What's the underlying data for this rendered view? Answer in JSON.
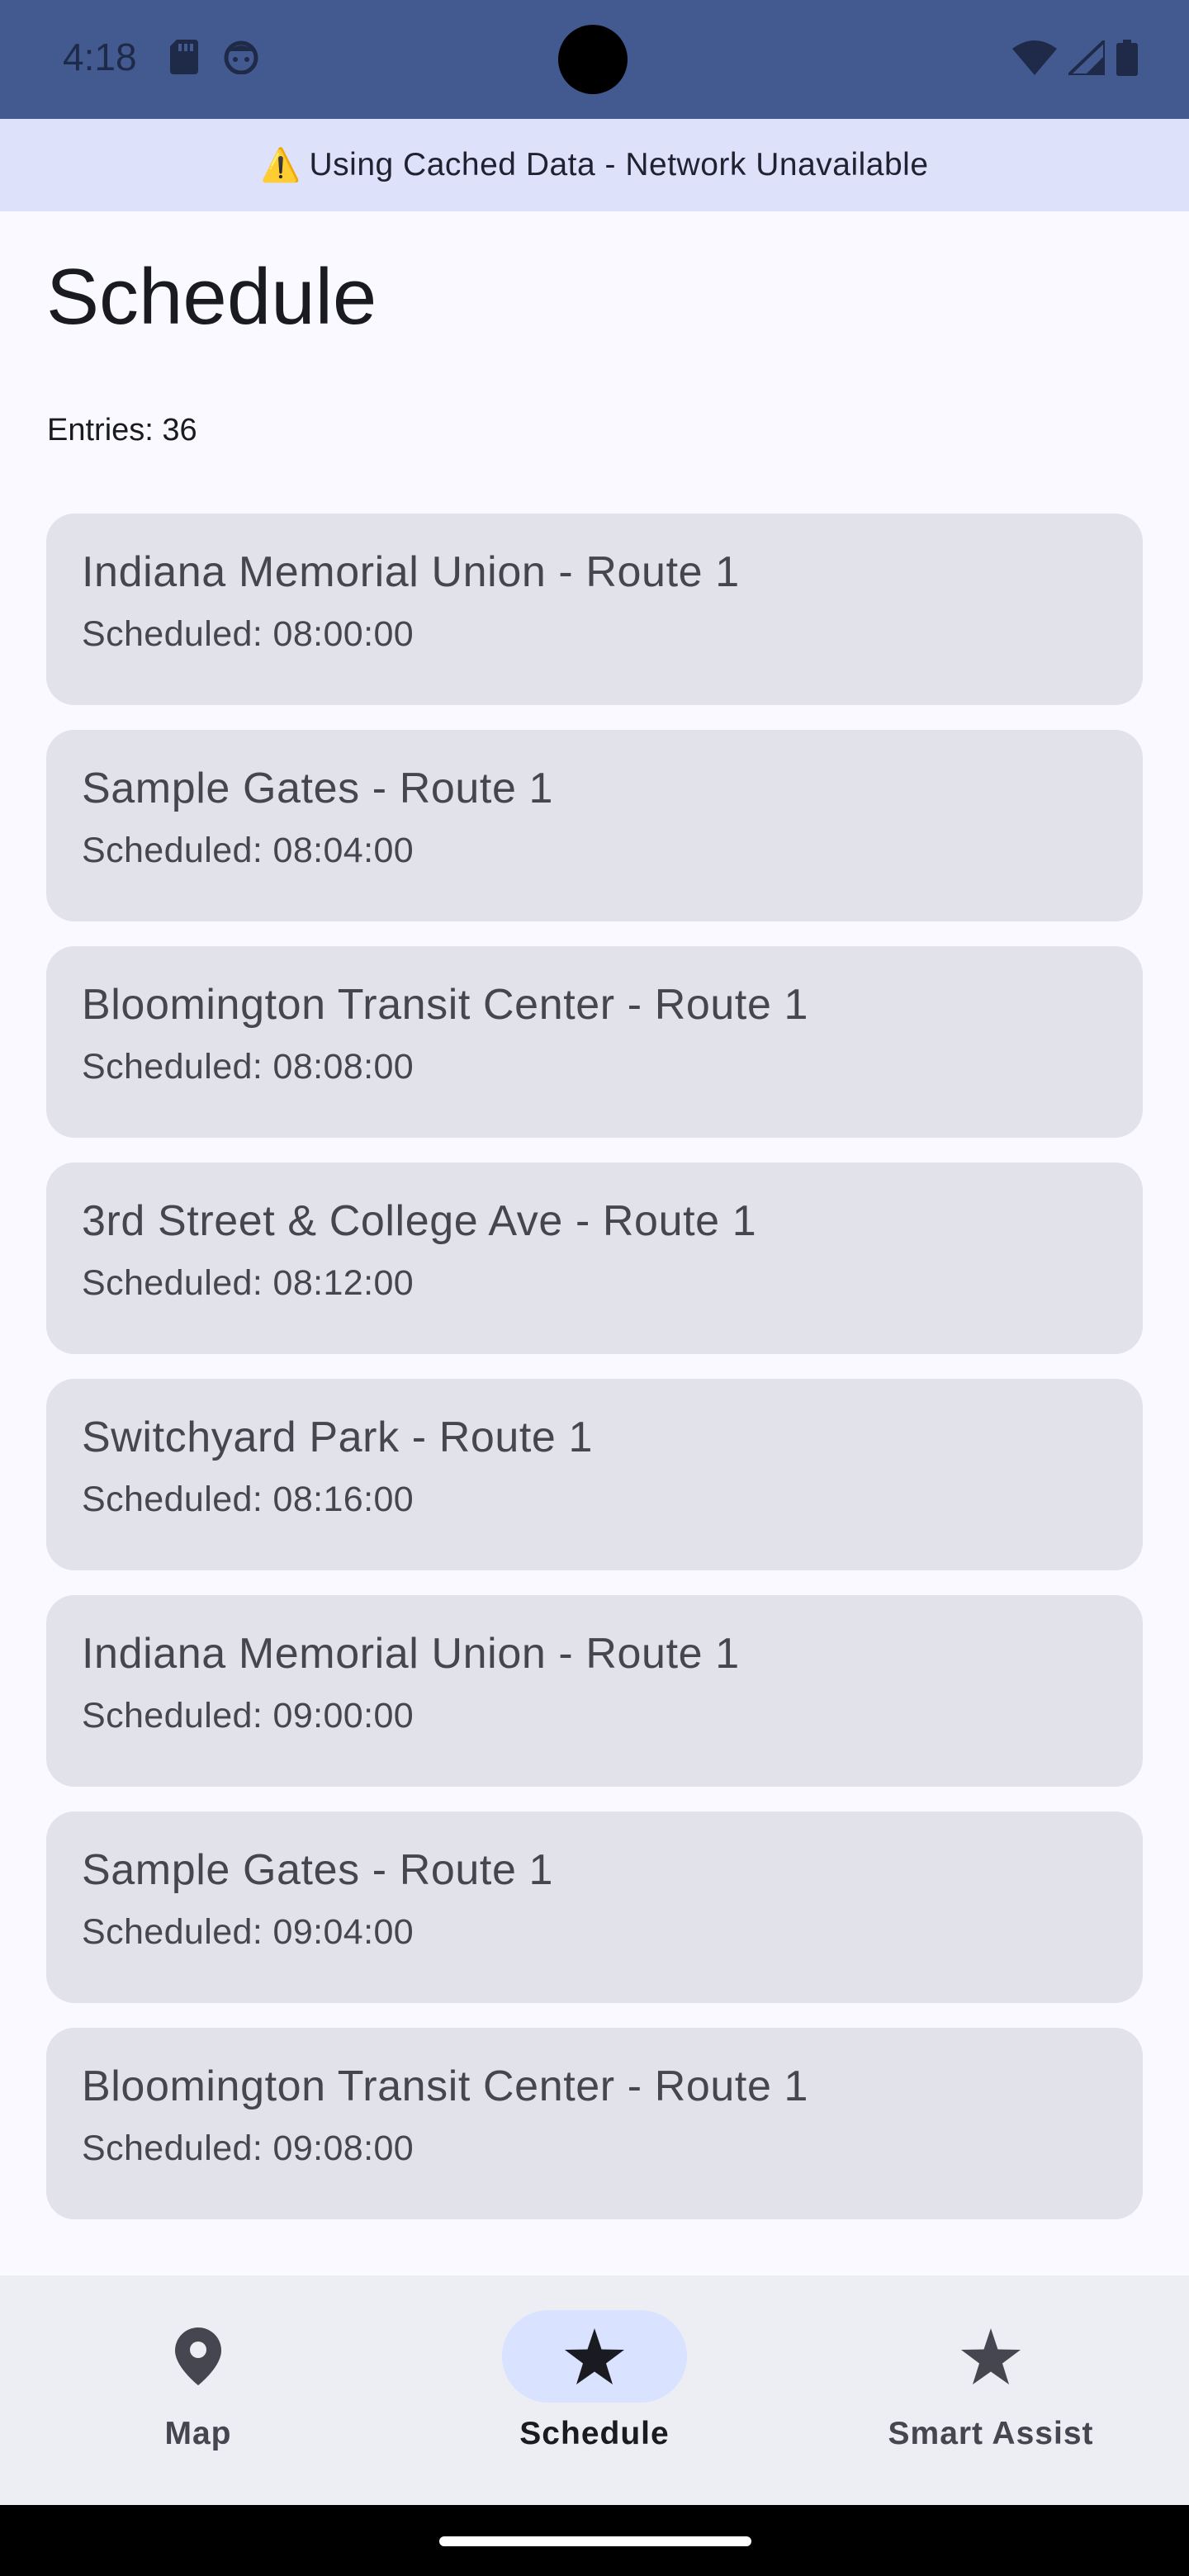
{
  "status_bar": {
    "time": "4:18",
    "left_icons": [
      "sd-card-icon",
      "android-face-icon"
    ],
    "right_icons": [
      "wifi-icon",
      "cell-signal-icon",
      "battery-icon"
    ],
    "bar_color": "#425a8f"
  },
  "banner": {
    "icon": "⚠️",
    "text": "Using Cached Data - Network Unavailable",
    "color": "#dde1f9"
  },
  "page": {
    "title": "Schedule",
    "entries_label": "Entries: 36"
  },
  "schedule": [
    {
      "stop": "Indiana Memorial Union - Route 1",
      "time": "Scheduled: 08:00:00"
    },
    {
      "stop": "Sample Gates - Route 1",
      "time": "Scheduled: 08:04:00"
    },
    {
      "stop": "Bloomington Transit Center - Route 1",
      "time": "Scheduled: 08:08:00"
    },
    {
      "stop": "3rd Street & College Ave - Route 1",
      "time": "Scheduled: 08:12:00"
    },
    {
      "stop": "Switchyard Park - Route 1",
      "time": "Scheduled: 08:16:00"
    },
    {
      "stop": "Indiana Memorial Union - Route 1",
      "time": "Scheduled: 09:00:00"
    },
    {
      "stop": "Sample Gates - Route 1",
      "time": "Scheduled: 09:04:00"
    },
    {
      "stop": "Bloomington Transit Center - Route 1",
      "time": "Scheduled: 09:08:00"
    }
  ],
  "nav": {
    "items": [
      {
        "label": "Map",
        "icon": "map-pin-icon",
        "active": false
      },
      {
        "label": "Schedule",
        "icon": "star-icon",
        "active": true
      },
      {
        "label": "Smart Assist",
        "icon": "star-icon",
        "active": false
      }
    ],
    "active_color": "#d9e2ff"
  }
}
